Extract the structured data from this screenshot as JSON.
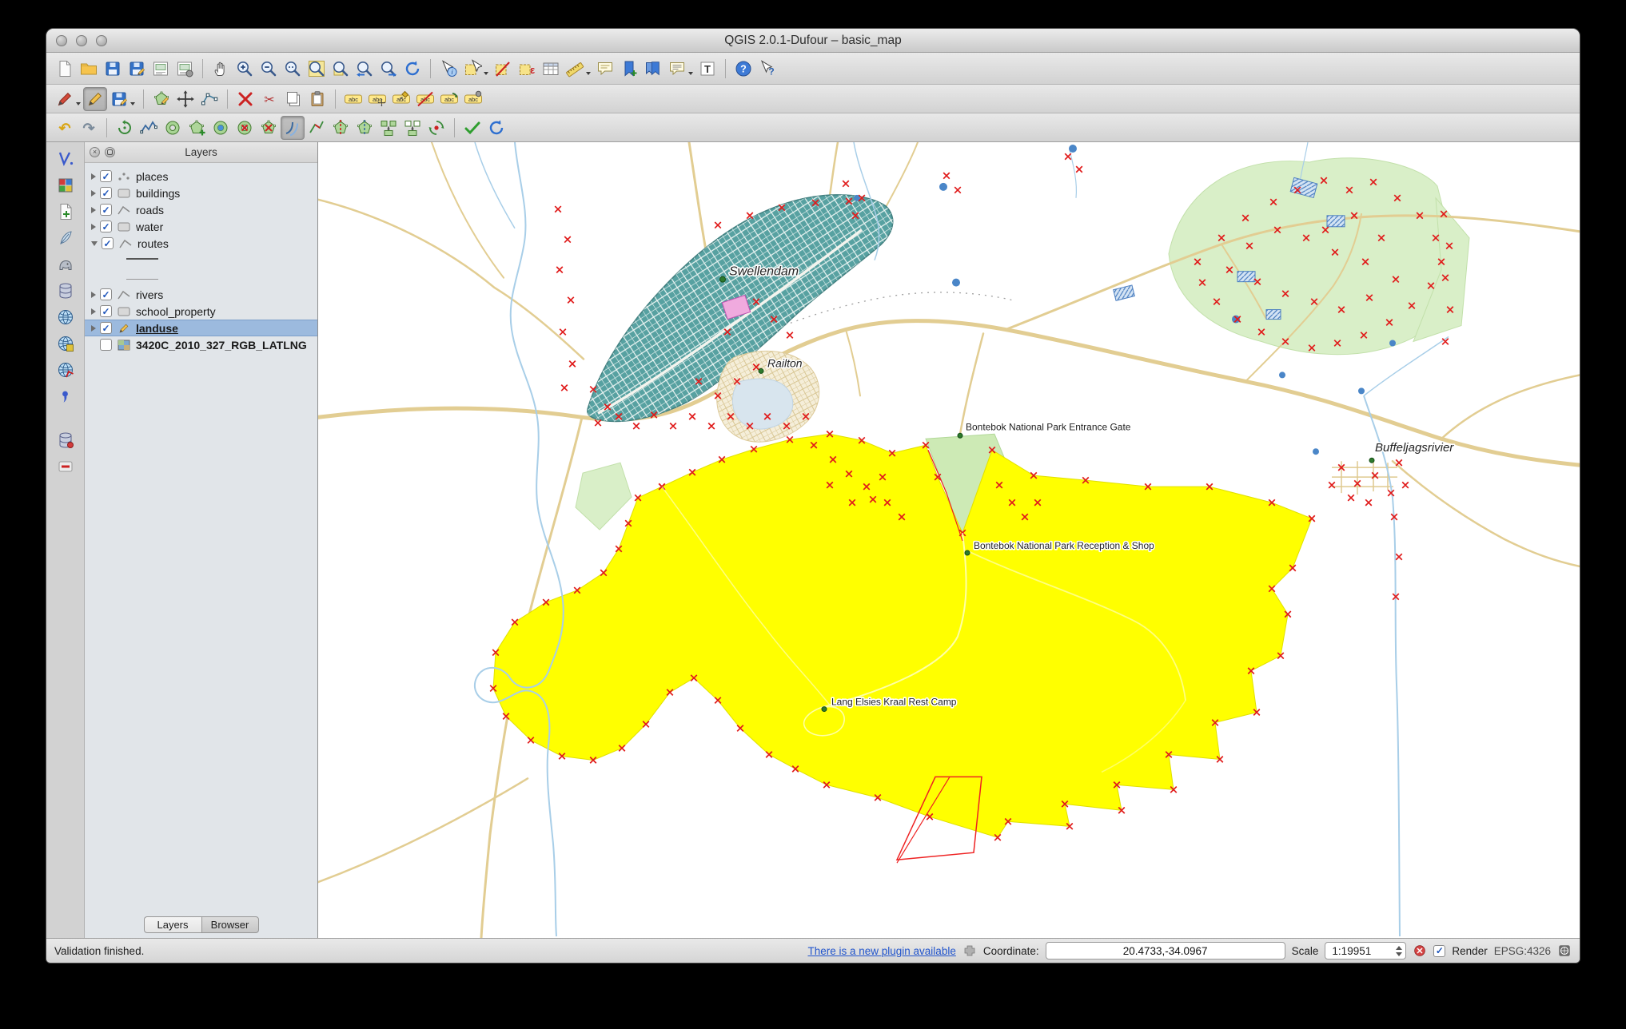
{
  "window": {
    "title": "QGIS 2.0.1-Dufour – basic_map"
  },
  "glyphs": {
    "abc": "abc",
    "question": "?",
    "identify": "i",
    "text": "T",
    "epsilon": "ε",
    "cut": "✂",
    "undo": "↶",
    "redo": "↷",
    "check": "✓",
    "close": "×"
  },
  "toolbars": {
    "file": [
      "new-project",
      "open-project",
      "save-project",
      "save-project-as",
      "new-print-composer",
      "composer-manager"
    ],
    "navigation": [
      "pan-map",
      "zoom-in",
      "zoom-out",
      "zoom-native",
      "zoom-full",
      "zoom-to-selection",
      "zoom-last",
      "zoom-next",
      "refresh"
    ],
    "attributes": [
      "identify",
      "select-features",
      "deselect-features",
      "select-by-expression",
      "open-attribute-table",
      "measure",
      "map-tips",
      "new-bookmark",
      "show-bookmarks",
      "annotation",
      "text-annotation"
    ],
    "help": [
      "help-contents",
      "whats-this"
    ],
    "digitizing": [
      "current-edits",
      "toggle-editing",
      "save-edits",
      "add-feature",
      "move-feature",
      "node-tool",
      "delete-selected",
      "cut-features",
      "copy-features",
      "paste-features"
    ],
    "labeling": [
      "labeling",
      "move-label",
      "pin-label",
      "show-hidden-labels",
      "rotate-label",
      "label-properties"
    ],
    "advanced_digitizing": [
      "undo",
      "redo",
      "rotate-feature",
      "simplify-feature",
      "add-ring",
      "add-part",
      "fill-ring",
      "delete-ring",
      "delete-part",
      "offset-curve",
      "reshape-features",
      "split-features",
      "split-parts",
      "merge-features",
      "merge-attributes",
      "rotate-point-symbols"
    ],
    "checks": [
      "check-geometries",
      "redraw"
    ],
    "manage_layers": [
      "add-vector-layer",
      "add-raster-layer",
      "new-shapefile-layer",
      "add-spatialite-layer",
      "add-postgis-layer",
      "add-mssql-layer",
      "add-wms-layer",
      "add-wcs-layer",
      "add-wfs-layer",
      "add-delimited-text-layer",
      "add-oracle-layer",
      "remove-layer"
    ]
  },
  "layers_panel": {
    "title": "Layers",
    "items": [
      {
        "label": "places",
        "checked": true
      },
      {
        "label": "buildings",
        "checked": true
      },
      {
        "label": "roads",
        "checked": true
      },
      {
        "label": "water",
        "checked": true
      },
      {
        "label": "routes",
        "checked": true,
        "expanded": true
      },
      {
        "label": "rivers",
        "checked": true
      },
      {
        "label": "school_property",
        "checked": true
      },
      {
        "label": "landuse",
        "checked": true,
        "selected": true,
        "editing": true
      },
      {
        "label": "3420C_2010_327_RGB_LATLNG",
        "checked": false
      }
    ],
    "tabs": [
      {
        "label": "Layers",
        "active": true
      },
      {
        "label": "Browser",
        "active": false
      }
    ]
  },
  "map": {
    "labels": [
      {
        "text": "Swellendam"
      },
      {
        "text": "Railton"
      },
      {
        "text": "Bontebok National Park Entrance Gate"
      },
      {
        "text": "Bontebok National Park Reception & Shop"
      },
      {
        "text": "Lang Elsies Kraal Rest Camp"
      },
      {
        "text": "Buffeljagsrivier"
      }
    ]
  },
  "statusbar": {
    "message": "Validation finished.",
    "plugin_link": "There is a new plugin available",
    "coordinate_label": "Coordinate:",
    "coordinate_value": "20.4733,-34.0967",
    "scale_label": "Scale",
    "scale_value": "1:19951",
    "render_label": "Render",
    "crs": "EPSG:4326"
  },
  "colors": {
    "landuse_fill": "#ffff00",
    "selection_marker": "#e01b1b",
    "town_fill": "#57a1a1",
    "vegetation_fill": "#d9efc8",
    "water_stroke": "#a8cee8",
    "road_stroke": "#e2cd92"
  }
}
